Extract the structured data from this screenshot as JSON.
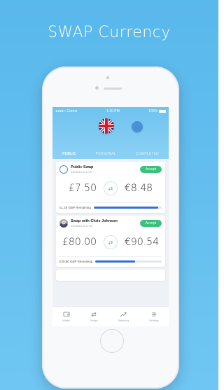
{
  "headline": "SWAP Currency",
  "status": {
    "carrier": "●●●●○ Carrier",
    "time": "1:20 PM",
    "battery": "100%"
  },
  "tabs": [
    {
      "label": "PUBLIC",
      "active": true
    },
    {
      "label": "PERSONAL",
      "active": false
    },
    {
      "label": "COMPLETED",
      "active": false
    }
  ],
  "swaps": [
    {
      "title": "Public Swap",
      "date": "14/05/18 at 10:07",
      "accept_label": "Accept",
      "amount_from": "£7.50",
      "amount_to": "€8.48",
      "remaining": "£1.20 GBP Remaining",
      "progress_percent": 95
    },
    {
      "title": "Swap with Chris Johnson",
      "date": "14/05/18 at 11:20",
      "accept_label": "Accept",
      "amount_from": "£80.00",
      "amount_to": "€90.54",
      "remaining": "£25.00 GBP Remaining",
      "progress_percent": 60
    }
  ],
  "tabbar": [
    {
      "label": "Wallet",
      "icon": "wallet-icon"
    },
    {
      "label": "Swaps",
      "icon": "swap-arrows-icon"
    },
    {
      "label": "Spending",
      "icon": "trend-icon"
    },
    {
      "label": "Settings",
      "icon": "gear-icon"
    }
  ],
  "colors": {
    "accent_green": "#3cc07d",
    "progress_blue": "#2f6fd7",
    "header_blue": "#6ec3ef"
  }
}
